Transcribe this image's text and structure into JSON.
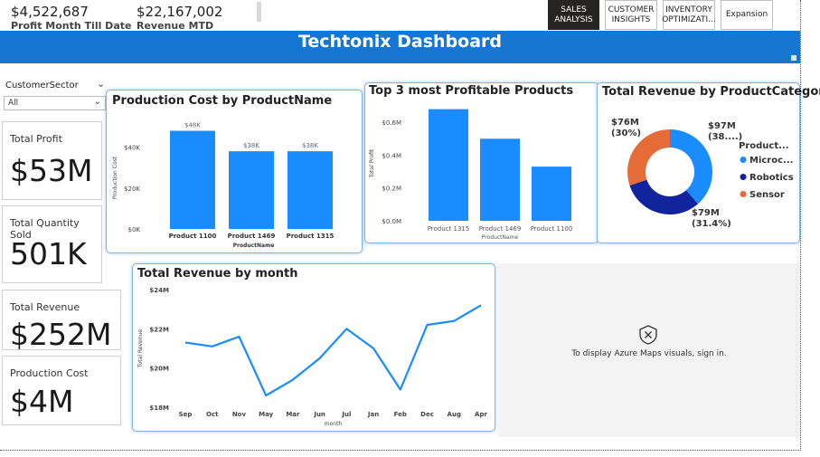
{
  "top_kpis": [
    {
      "value": "$4,522,687",
      "label": "Profit Month Till Date"
    },
    {
      "value": "$22,167,002",
      "label": "Revenue MTD"
    }
  ],
  "nav_tabs": [
    {
      "label": "SALES ANALYSIS",
      "active": true
    },
    {
      "label": "CUSTOMER INSIGHTS",
      "active": false
    },
    {
      "label": "INVENTORY OPTIMIZATI...",
      "active": false
    },
    {
      "label": "Expansion",
      "active": false
    }
  ],
  "banner": {
    "title": "Techtonix Dashboard",
    "color": "#1677d2"
  },
  "slicer": {
    "title": "CustomerSector",
    "value": "All",
    "chevron_icon": "chevron-down-icon"
  },
  "cards": [
    {
      "label": "Total Profit",
      "value": "$53M"
    },
    {
      "label": "Total Quantity Sold",
      "value": "501K"
    },
    {
      "label": "Total Revenue",
      "value": "$252M"
    },
    {
      "label": "Production Cost",
      "value": "$4M"
    }
  ],
  "map": {
    "message": "To display Azure Maps visuals, sign in.",
    "icon": "map-error-icon"
  },
  "colors": {
    "bar": "#1a8cff",
    "line": "#1a8cff",
    "microchip": "#1a8cff",
    "robotics": "#12239e",
    "sensor": "#e66c37"
  },
  "chart_data": [
    {
      "type": "bar",
      "title": "Production Cost by ProductName",
      "categories": [
        "Product 1100",
        "Product 1469",
        "Product 1315"
      ],
      "values": [
        48,
        38,
        38
      ],
      "data_labels": [
        "$48K",
        "$38K",
        "$38K"
      ],
      "xlabel": "ProductName",
      "ylabel": "Production Cost",
      "yticks": [
        "$0K",
        "$20K",
        "$40K"
      ],
      "ylim": [
        0,
        50
      ]
    },
    {
      "type": "bar",
      "title": "Top 3 most Profitable Products",
      "categories": [
        "Product 1315",
        "Product 1469",
        "Product 1100"
      ],
      "values": [
        0.68,
        0.5,
        0.33
      ],
      "xlabel": "ProductName",
      "ylabel": "Total Profit",
      "yticks": [
        "$0.0M",
        "$0.2M",
        "$0.4M",
        "$0.6M"
      ],
      "ylim": [
        0,
        0.7
      ]
    },
    {
      "type": "pie",
      "title": "Total Revenue by ProductCategory",
      "legend_title": "Product...",
      "legend_position": "right",
      "slices": [
        {
          "name": "Microc...",
          "value": 97,
          "label": "$97M",
          "pct_label": "(38....)"
        },
        {
          "name": "Robotics",
          "value": 79,
          "label": "$79M",
          "pct_label": "(31.4%)"
        },
        {
          "name": "Sensor",
          "value": 76,
          "label": "$76M",
          "pct_label": "(30%)"
        }
      ]
    },
    {
      "type": "line",
      "title": "Total Revenue by month",
      "x": [
        "Sep",
        "Oct",
        "Nov",
        "May",
        "Mar",
        "Jun",
        "Jul",
        "Jan",
        "Feb",
        "Dec",
        "Aug",
        "Apr"
      ],
      "values": [
        21.3,
        21.1,
        21.6,
        18.6,
        19.4,
        20.5,
        22.0,
        21.0,
        18.9,
        22.2,
        22.4,
        23.2
      ],
      "xlabel": "month",
      "ylabel": "Total Revenue",
      "yticks": [
        "$18M",
        "$20M",
        "$22M",
        "$24M"
      ],
      "ylim": [
        18,
        24
      ]
    }
  ]
}
